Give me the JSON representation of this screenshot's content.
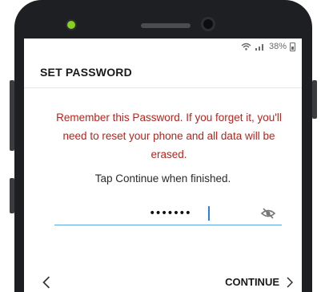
{
  "status": {
    "battery_text": "38%",
    "icons": [
      "wifi-icon",
      "signal-icon",
      "battery-icon"
    ]
  },
  "screen": {
    "title": "SET PASSWORD",
    "warning_text": "Remember this Password. If you forget it, you'll need to reset your phone and all data will be erased.",
    "hint_text": "Tap Continue when finished.",
    "password_field": {
      "masked_value": "•••••••",
      "visibility_toggle_icon": "eye-off-icon"
    }
  },
  "footer": {
    "back_icon": "chevron-left-icon",
    "continue_label": "CONTINUE",
    "continue_icon": "chevron-right-icon"
  },
  "colors": {
    "warning": "#b3261e",
    "field_underline": "#5aa9e6",
    "cursor": "#2b7de9"
  }
}
